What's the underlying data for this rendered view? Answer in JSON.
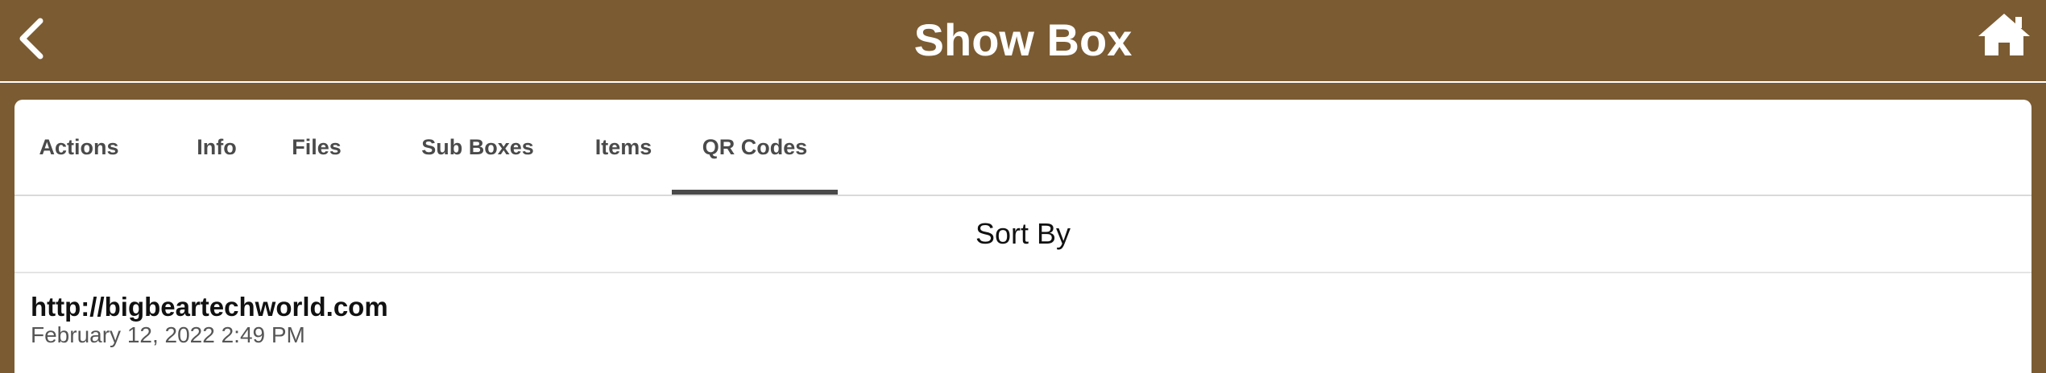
{
  "header": {
    "title": "Show Box",
    "back_icon": "chevron-left-icon",
    "home_icon": "home-icon"
  },
  "tabs": [
    {
      "label": "Actions",
      "active": false
    },
    {
      "label": "Info",
      "active": false
    },
    {
      "label": "Files",
      "active": false
    },
    {
      "label": "Sub Boxes",
      "active": false
    },
    {
      "label": "Items",
      "active": false
    },
    {
      "label": "QR Codes",
      "active": true
    }
  ],
  "sort": {
    "label": "Sort By"
  },
  "qr_codes": [
    {
      "url": "http://bigbeartechworld.com",
      "date": "February 12, 2022 2:49 PM"
    }
  ],
  "colors": {
    "brand": "#7b5b32",
    "header_text": "#ffffff",
    "tab_text": "#4a4a4a",
    "active_indicator": "#4a4a4a",
    "card_bg": "#ffffff"
  }
}
